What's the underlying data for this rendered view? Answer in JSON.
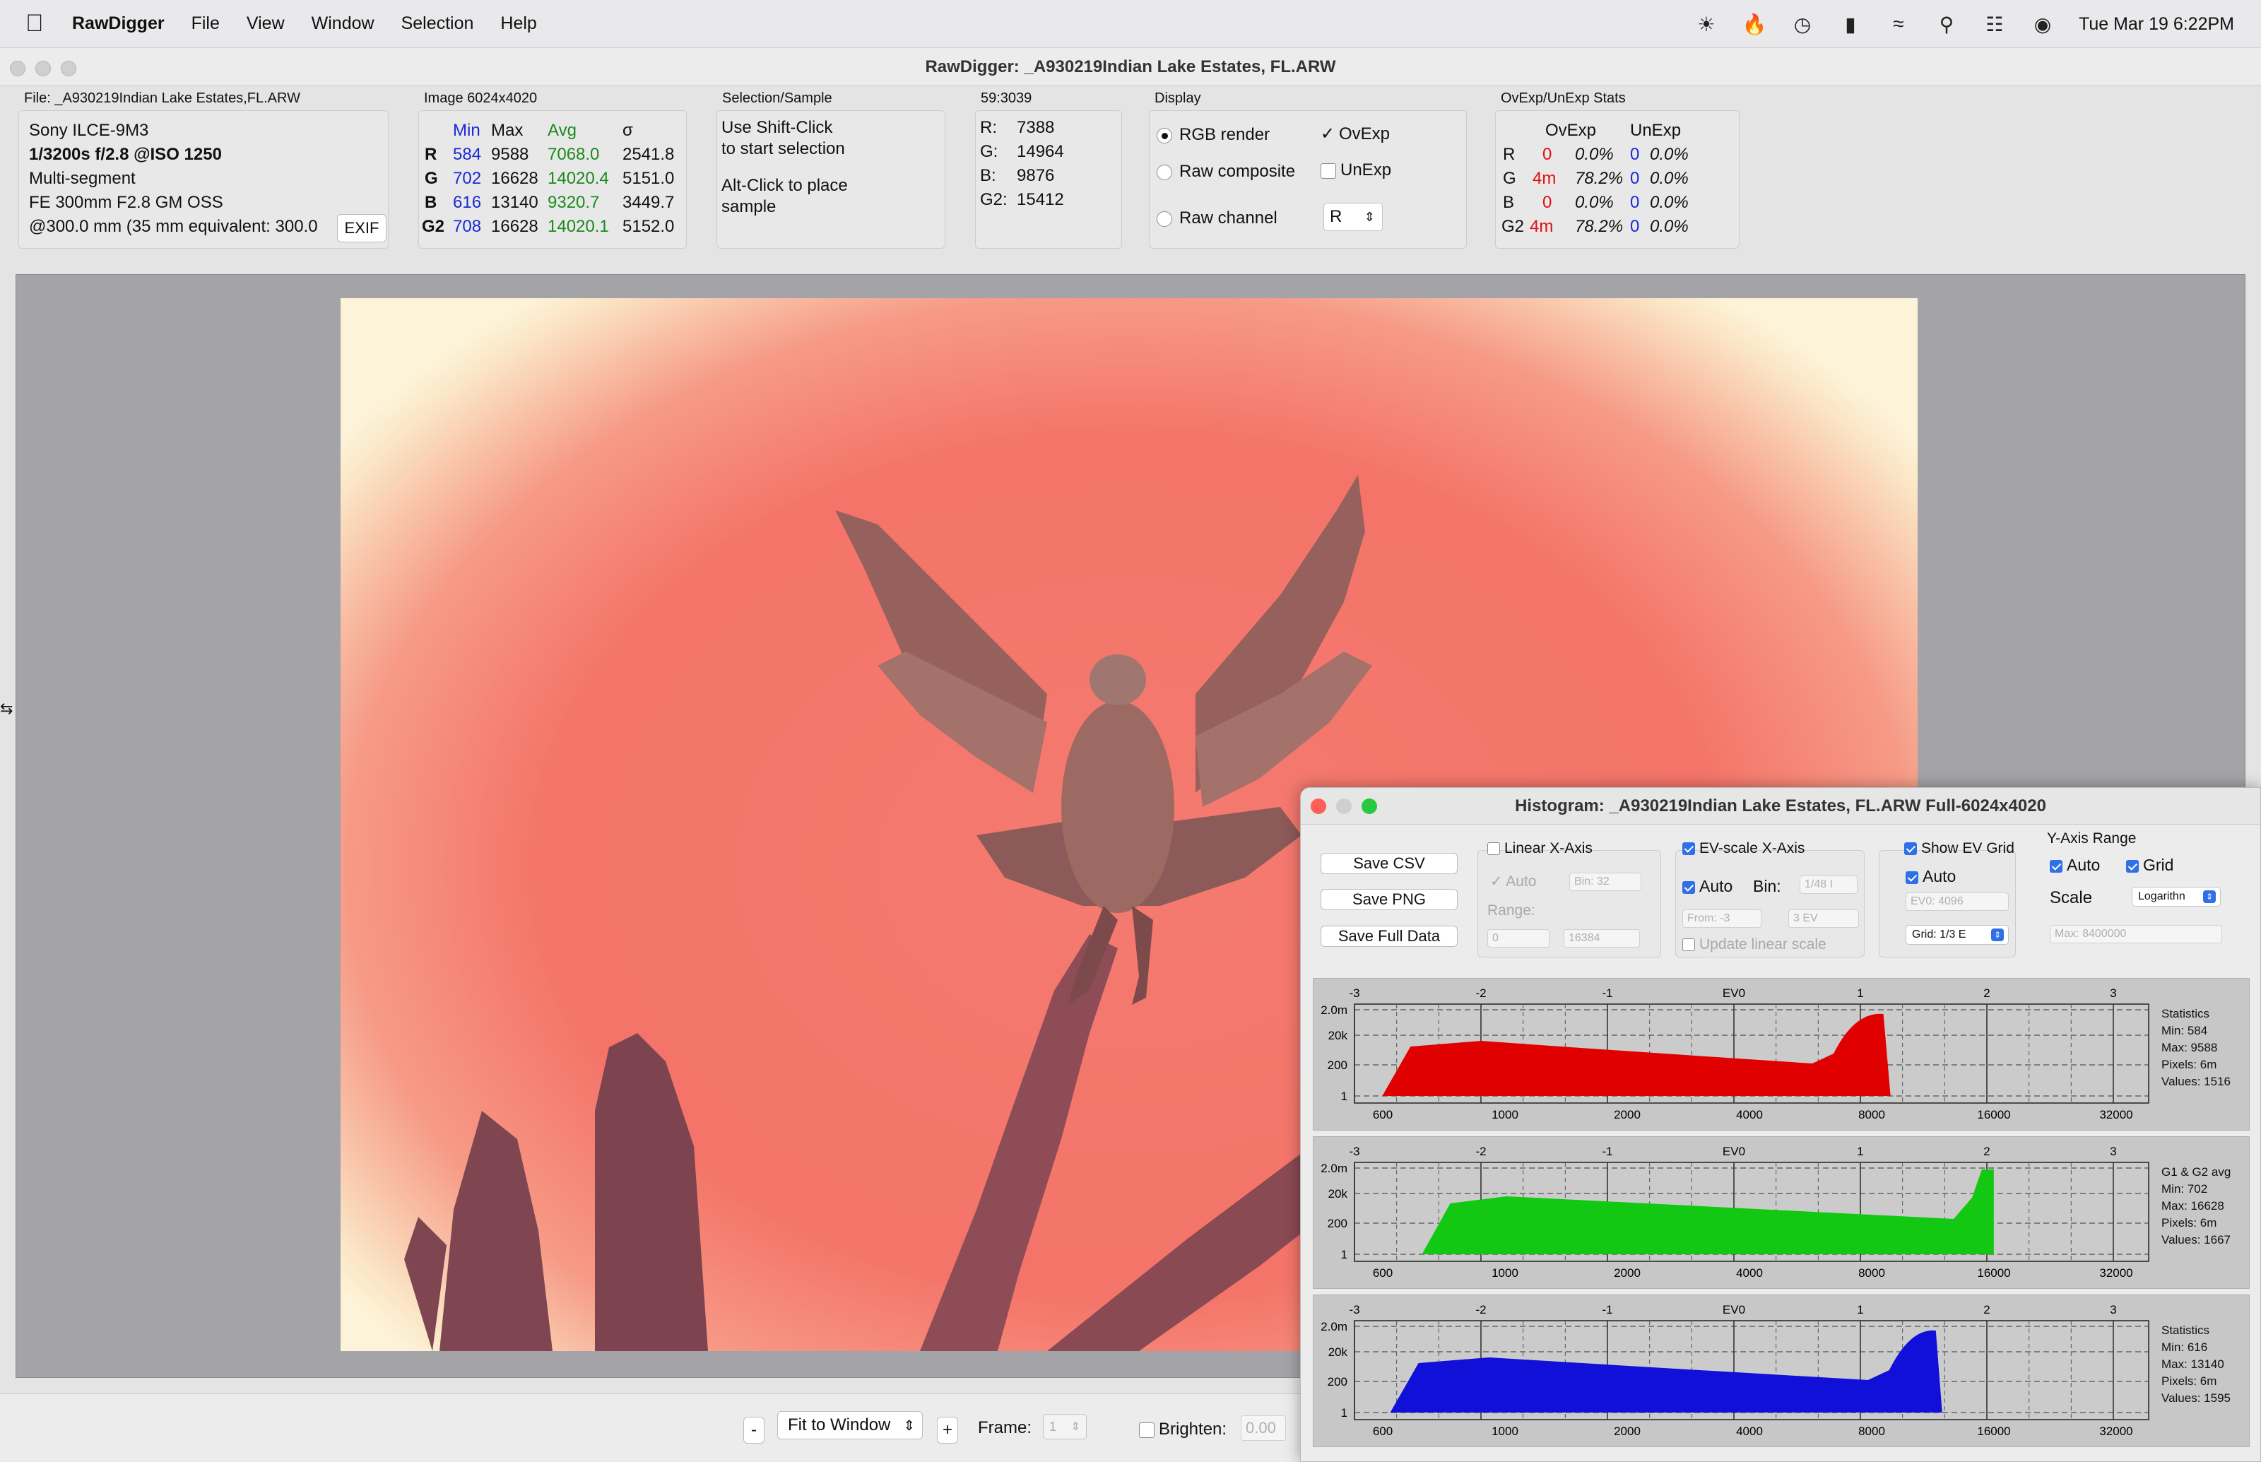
{
  "menubar": {
    "apple": "",
    "app": "RawDigger",
    "items": [
      "File",
      "View",
      "Window",
      "Selection",
      "Help"
    ],
    "clock": "Tue Mar 19  6:22PM"
  },
  "window": {
    "title": "RawDigger: _A930219Indian Lake Estates, FL.ARW"
  },
  "file_panel": {
    "title": "File: _A930219Indian Lake Estates,FL.ARW",
    "camera": "Sony ILCE-9M3",
    "exposure": "1/3200s f/2.8 @ISO 1250",
    "metering": "Multi-segment",
    "lens": "FE 300mm F2.8 GM OSS",
    "focal": "@300.0 mm (35 mm equivalent: 300.0",
    "exif_button": "EXIF"
  },
  "image_panel": {
    "title": "Image 6024x4020",
    "headers": [
      "Min",
      "Max",
      "Avg",
      "σ"
    ],
    "rows": [
      {
        "ch": "R",
        "min": "584",
        "max": "9588",
        "avg": "7068.0",
        "sd": "2541.8"
      },
      {
        "ch": "G",
        "min": "702",
        "max": "16628",
        "avg": "14020.4",
        "sd": "5151.0"
      },
      {
        "ch": "B",
        "min": "616",
        "max": "13140",
        "avg": "9320.7",
        "sd": "3449.7"
      },
      {
        "ch": "G2",
        "min": "708",
        "max": "16628",
        "avg": "14020.1",
        "sd": "5152.0"
      }
    ]
  },
  "selection_panel": {
    "title": "Selection/Sample",
    "line1": "Use Shift-Click",
    "line2": "to start selection",
    "line3": "Alt-Click to place",
    "line4": "sample"
  },
  "pixel_panel": {
    "title": "59:3039",
    "values": [
      {
        "k": "R:",
        "v": "7388"
      },
      {
        "k": "G:",
        "v": "14964"
      },
      {
        "k": "B:",
        "v": "9876"
      },
      {
        "k": "G2:",
        "v": "15412"
      }
    ]
  },
  "display_panel": {
    "title": "Display",
    "rgb_render": "RGB render",
    "raw_composite": "Raw composite",
    "raw_channel": "Raw channel",
    "ovexp": "OvExp",
    "unexp": "UnExp",
    "channel_value": "R"
  },
  "exp_panel": {
    "title": "OvExp/UnExp Stats",
    "headers": [
      "OvExp",
      "UnExp"
    ],
    "rows": [
      {
        "ch": "R",
        "ov": "0",
        "ovp": "0.0%",
        "un": "0",
        "unp": "0.0%"
      },
      {
        "ch": "G",
        "ov": "4m",
        "ovp": "78.2%",
        "un": "0",
        "unp": "0.0%"
      },
      {
        "ch": "B",
        "ov": "0",
        "ovp": "0.0%",
        "un": "0",
        "unp": "0.0%"
      },
      {
        "ch": "G2",
        "ov": "4m",
        "ovp": "78.2%",
        "un": "0",
        "unp": "0.0%"
      }
    ]
  },
  "bottom": {
    "minus": "-",
    "fit": "Fit to Window",
    "plus": "+",
    "frame_label": "Frame:",
    "frame_value": "1",
    "brighten_label": "Brighten:",
    "brighten_value": "0.00"
  },
  "histogram": {
    "title": "Histogram: _A930219Indian Lake Estates, FL.ARW Full-6024x4020",
    "save_csv": "Save CSV",
    "save_png": "Save PNG",
    "save_full": "Save Full Data",
    "linear": {
      "label": "Linear X-Axis",
      "auto": "Auto",
      "bin": "Bin: 32",
      "range": "Range:",
      "from": "0",
      "to": "16384"
    },
    "ev": {
      "label": "EV-scale X-Axis",
      "auto": "Auto",
      "bin_label": "Bin:",
      "bin": "1/48 I",
      "from": "From: -3",
      "to": "3 EV",
      "update": "Update linear scale"
    },
    "evgrid": {
      "label": "Show EV Grid",
      "auto": "Auto",
      "ev0": "EV0: 4096",
      "grid": "Grid: 1/3 E"
    },
    "yaxis": {
      "label": "Y-Axis Range",
      "auto": "Auto",
      "grid": "Grid",
      "scale": "Scale",
      "scale_value": "Logarithn",
      "max": "Max: 8400000"
    },
    "ev_ticks": [
      "-3",
      "-2",
      "-1",
      "EV0",
      "1",
      "2",
      "3"
    ],
    "x_ticks": [
      "600",
      "1000",
      "2000",
      "4000",
      "8000",
      "16000",
      "32000"
    ],
    "y_ticks": [
      "2.0m",
      "20k",
      "200",
      "1"
    ],
    "stats": [
      {
        "title": "Statistics",
        "min": "Min: 584",
        "max": "Max: 9588",
        "pixels": "Pixels: 6m",
        "values": "Values: 1516",
        "color": "#e00000"
      },
      {
        "title": "G1 & G2 avg",
        "min": "Min: 702",
        "max": "Max: 16628",
        "pixels": "Pixels: 6m",
        "values": "Values: 1667",
        "color": "#12c812"
      },
      {
        "title": "Statistics",
        "min": "Min: 616",
        "max": "Max: 13140",
        "pixels": "Pixels: 6m",
        "values": "Values: 1595",
        "color": "#1010d8"
      }
    ]
  }
}
